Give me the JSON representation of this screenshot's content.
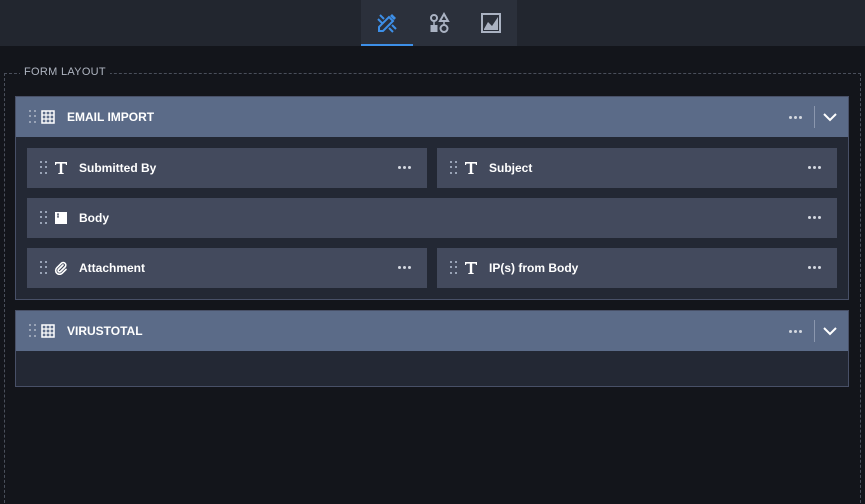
{
  "toolbar": {
    "tabs": [
      {
        "name": "design-tab",
        "icon": "pencil-ruler-icon",
        "active": true
      },
      {
        "name": "shapes-tab",
        "icon": "shapes-icon",
        "active": false
      },
      {
        "name": "chart-tab",
        "icon": "area-chart-icon",
        "active": false
      }
    ],
    "accent_color": "#3d8fe8"
  },
  "layout": {
    "legend": "FORM LAYOUT"
  },
  "sections": [
    {
      "title": "EMAIL IMPORT",
      "fields": [
        {
          "label": "Submitted By",
          "icon": "text-icon"
        },
        {
          "label": "Subject",
          "icon": "text-icon"
        },
        {
          "label": "Body",
          "icon": "rich-text-icon"
        },
        {
          "label": "Attachment",
          "icon": "paperclip-icon"
        },
        {
          "label": "IP(s) from Body",
          "icon": "text-icon"
        }
      ]
    },
    {
      "title": "VIRUSTOTAL",
      "fields": []
    }
  ]
}
